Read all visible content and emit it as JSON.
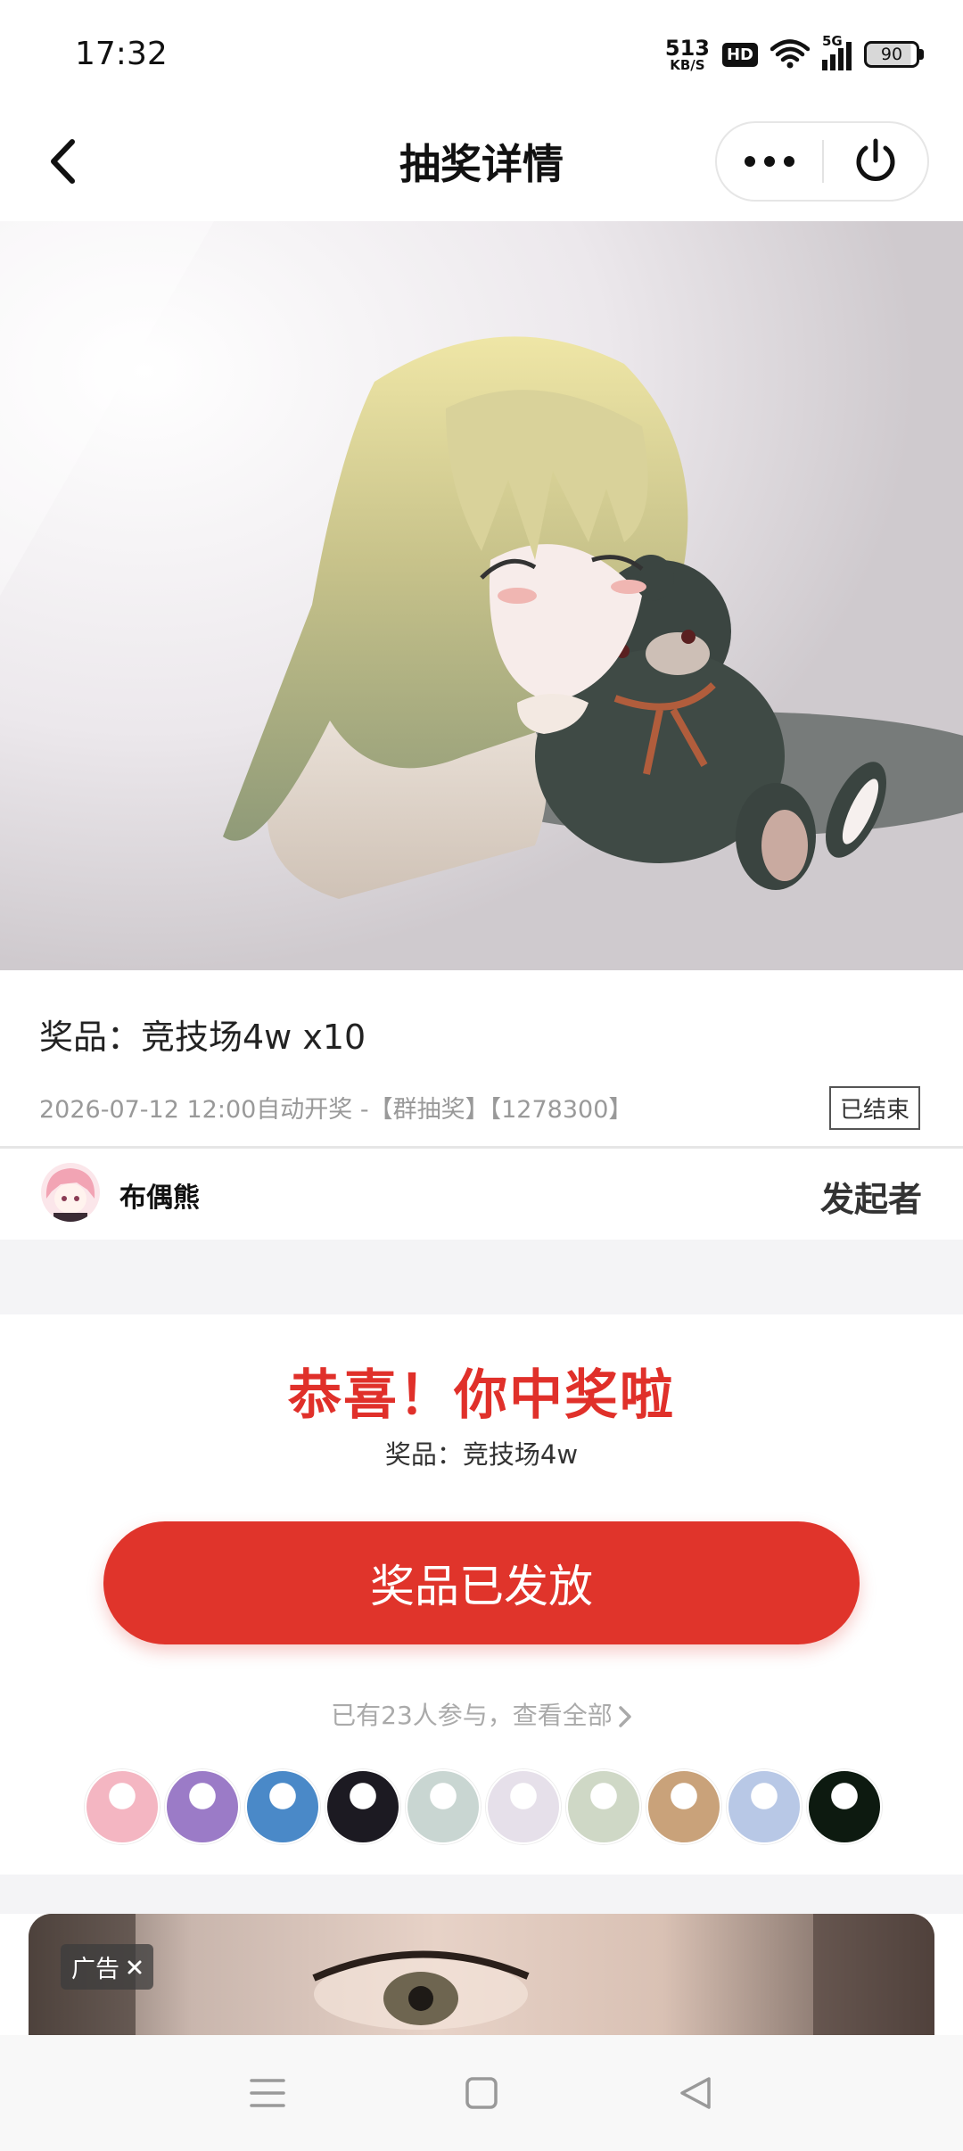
{
  "status_bar": {
    "time": "17:32",
    "net_speed": "513",
    "net_unit": "KB/S",
    "hd": "HD",
    "signal_label": "5G",
    "battery": "90"
  },
  "nav": {
    "title": "抽奖详情",
    "back_icon": "chevron-left-icon",
    "more_icon": "more-dots-icon",
    "close_icon": "power-icon"
  },
  "prize_info": {
    "title": "奖品：竞技场4w x10",
    "meta": "2026-07-12 12:00自动开奖 -【群抽奖】【1278300】",
    "status_badge": "已结束"
  },
  "organizer": {
    "name": "布偶熊",
    "role": "发起者"
  },
  "result": {
    "title": "恭喜！你中奖啦",
    "prize": "奖品：竞技场4w",
    "button_label": "奖品已发放",
    "participants_link": "已有23人参与，查看全部"
  },
  "participants": {
    "avatar_colors": [
      "#f4b6c2",
      "#9b7bc7",
      "#4a89c8",
      "#1c1a22",
      "#c9d6d2",
      "#e6e0ea",
      "#cfd8c6",
      "#c9a27a",
      "#b8c8e6",
      "#0d1a10"
    ]
  },
  "ad": {
    "badge": "广告"
  },
  "colors": {
    "accent_red": "#e0342b",
    "meta_gray": "#999999",
    "page_gray": "#f4f4f6"
  }
}
